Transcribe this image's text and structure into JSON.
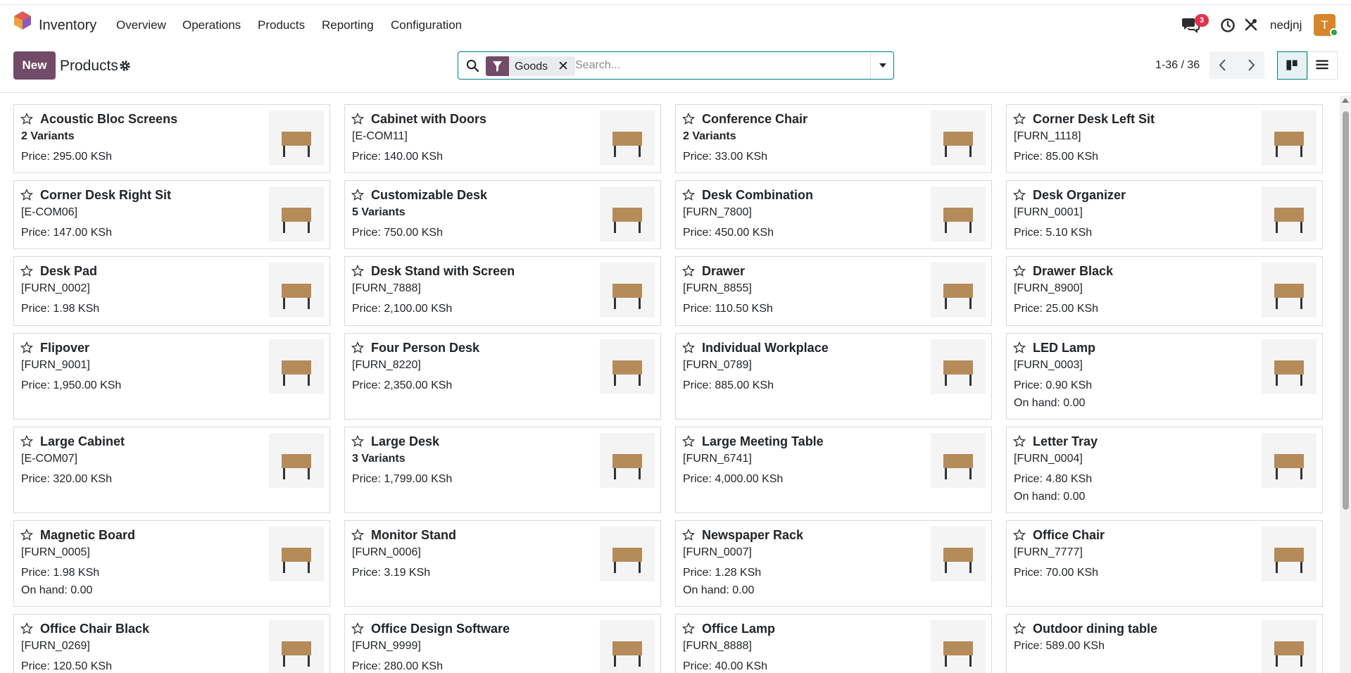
{
  "nav": {
    "app_name": "Inventory",
    "menus": [
      "Overview",
      "Operations",
      "Products",
      "Reporting",
      "Configuration"
    ],
    "chat_count": "3",
    "user_name": "nedjnj",
    "avatar_letter": "T",
    "brand_color": "#714b67",
    "accent_color": "#017e84"
  },
  "control": {
    "new_label": "New",
    "title": "Products",
    "filter_label": "Goods",
    "filter_close": "✕",
    "search_placeholder": "Search...",
    "pager": "1-36 / 36"
  },
  "products": [
    {
      "name": "Acoustic Bloc Screens",
      "line2": "2 Variants",
      "variants": true,
      "price": "Price: 295.00 KSh",
      "onhand": "",
      "icon": "screen-image"
    },
    {
      "name": "Cabinet with Doors",
      "line2": "[E-COM11]",
      "variants": false,
      "price": "Price: 140.00 KSh",
      "onhand": "",
      "icon": "cabinet-image"
    },
    {
      "name": "Conference Chair",
      "line2": "2 Variants",
      "variants": true,
      "price": "Price: 33.00 KSh",
      "onhand": "",
      "icon": "chair-image"
    },
    {
      "name": "Corner Desk Left Sit",
      "line2": "[FURN_1118]",
      "variants": false,
      "price": "Price: 85.00 KSh",
      "onhand": "",
      "icon": "desk-image"
    },
    {
      "name": "Corner Desk Right Sit",
      "line2": "[E-COM06]",
      "variants": false,
      "price": "Price: 147.00 KSh",
      "onhand": "",
      "icon": "desk-image"
    },
    {
      "name": "Customizable Desk",
      "line2": "5 Variants",
      "variants": true,
      "price": "Price: 750.00 KSh",
      "onhand": "",
      "icon": "desk-image"
    },
    {
      "name": "Desk Combination",
      "line2": "[FURN_7800]",
      "variants": false,
      "price": "Price: 450.00 KSh",
      "onhand": "",
      "icon": "desk-image"
    },
    {
      "name": "Desk Organizer",
      "line2": "[FURN_0001]",
      "variants": false,
      "price": "Price: 5.10 KSh",
      "onhand": "",
      "icon": "organizer-image"
    },
    {
      "name": "Desk Pad",
      "line2": "[FURN_0002]",
      "variants": false,
      "price": "Price: 1.98 KSh",
      "onhand": "",
      "icon": "pad-image"
    },
    {
      "name": "Desk Stand with Screen",
      "line2": "[FURN_7888]",
      "variants": false,
      "price": "Price: 2,100.00 KSh",
      "onhand": "",
      "icon": "desk-image"
    },
    {
      "name": "Drawer",
      "line2": "[FURN_8855]",
      "variants": false,
      "price": "Price: 110.50 KSh",
      "onhand": "",
      "icon": "drawer-image"
    },
    {
      "name": "Drawer Black",
      "line2": "[FURN_8900]",
      "variants": false,
      "price": "Price: 25.00 KSh",
      "onhand": "",
      "icon": "drawer-image"
    },
    {
      "name": "Flipover",
      "line2": "[FURN_9001]",
      "variants": false,
      "price": "Price: 1,950.00 KSh",
      "onhand": "",
      "icon": "flipover-image"
    },
    {
      "name": "Four Person Desk",
      "line2": "[FURN_8220]",
      "variants": false,
      "price": "Price: 2,350.00 KSh",
      "onhand": "",
      "icon": "desk-image"
    },
    {
      "name": "Individual Workplace",
      "line2": "[FURN_0789]",
      "variants": false,
      "price": "Price: 885.00 KSh",
      "onhand": "",
      "icon": "pod-image"
    },
    {
      "name": "LED Lamp",
      "line2": "[FURN_0003]",
      "variants": false,
      "price": "Price: 0.90 KSh",
      "onhand": "On hand: 0.00",
      "icon": "lamp-image"
    },
    {
      "name": "Large Cabinet",
      "line2": "[E-COM07]",
      "variants": false,
      "price": "Price: 320.00 KSh",
      "onhand": "",
      "icon": "cabinet-image"
    },
    {
      "name": "Large Desk",
      "line2": "3 Variants",
      "variants": true,
      "price": "Price: 1,799.00 KSh",
      "onhand": "",
      "icon": "desk-image"
    },
    {
      "name": "Large Meeting Table",
      "line2": "[FURN_6741]",
      "variants": false,
      "price": "Price: 4,000.00 KSh",
      "onhand": "",
      "icon": "table-image"
    },
    {
      "name": "Letter Tray",
      "line2": "[FURN_0004]",
      "variants": false,
      "price": "Price: 4.80 KSh",
      "onhand": "On hand: 0.00",
      "icon": "tray-image"
    },
    {
      "name": "Magnetic Board",
      "line2": "[FURN_0005]",
      "variants": false,
      "price": "Price: 1.98 KSh",
      "onhand": "On hand: 0.00",
      "icon": "board-image"
    },
    {
      "name": "Monitor Stand",
      "line2": "[FURN_0006]",
      "variants": false,
      "price": "Price: 3.19 KSh",
      "onhand": "",
      "icon": "stand-image"
    },
    {
      "name": "Newspaper Rack",
      "line2": "[FURN_0007]",
      "variants": false,
      "price": "Price: 1.28 KSh",
      "onhand": "On hand: 0.00",
      "icon": "rack-image"
    },
    {
      "name": "Office Chair",
      "line2": "[FURN_7777]",
      "variants": false,
      "price": "Price: 70.00 KSh",
      "onhand": "",
      "icon": "chair-image"
    },
    {
      "name": "Office Chair Black",
      "line2": "[FURN_0269]",
      "variants": false,
      "price": "Price: 120.50 KSh",
      "onhand": "",
      "icon": "chair-image"
    },
    {
      "name": "Office Design Software",
      "line2": "[FURN_9999]",
      "variants": false,
      "price": "Price: 280.00 KSh",
      "onhand": "",
      "icon": "software-image"
    },
    {
      "name": "Office Lamp",
      "line2": "[FURN_8888]",
      "variants": false,
      "price": "Price: 40.00 KSh",
      "onhand": "",
      "icon": "lamp-image"
    },
    {
      "name": "Outdoor dining table",
      "line2": "Price: 589.00 KSh",
      "variants": false,
      "price": "",
      "onhand": "",
      "icon": "table-image"
    }
  ]
}
